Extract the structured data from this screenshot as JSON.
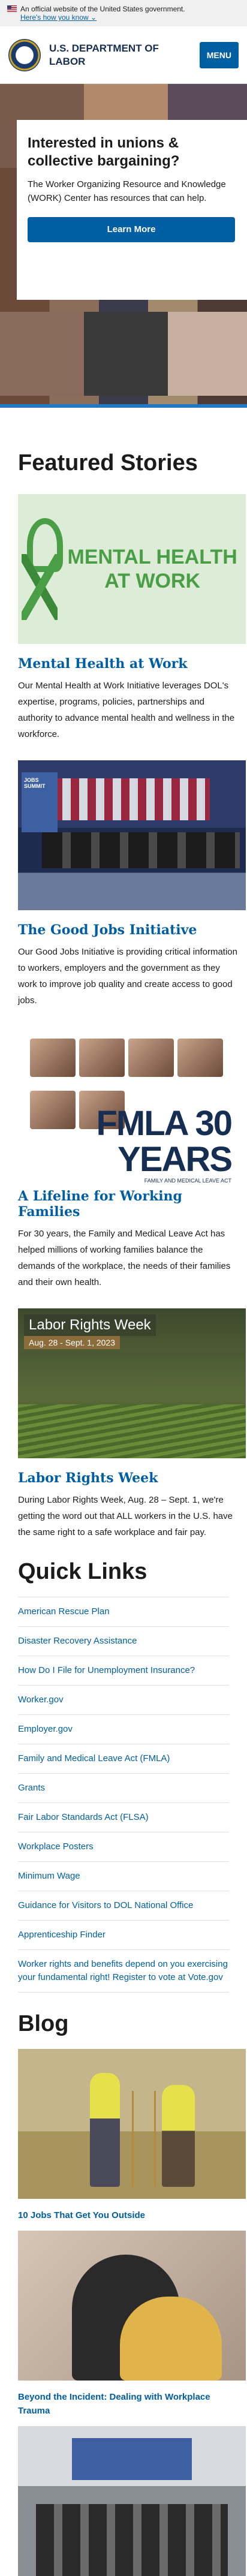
{
  "gov_banner": {
    "text": "An official website of the United States government.",
    "link": "Here's how you know"
  },
  "header": {
    "agency": "U.S. DEPARTMENT OF LABOR",
    "menu": "MENU"
  },
  "hero": {
    "title": "Interested in unions & collective bargaining?",
    "text": "The Worker Organizing Resource and Knowledge (WORK) Center has resources that can help.",
    "cta": "Learn More"
  },
  "featured": {
    "heading": "Featured Stories",
    "stories": [
      {
        "title": "Mental Health at Work",
        "image_text": "MENTAL HEALTH AT WORK",
        "text": "Our Mental Health at Work Initiative leverages DOL's expertise, programs, policies, partnerships and authority to advance mental health and wellness in the workforce."
      },
      {
        "title": "The Good Jobs Initiative",
        "image_text": "JOBS SUMMIT",
        "text": "Our Good Jobs Initiative is providing critical information to workers, employers and the government as they work to improve job quality and create access to good jobs."
      },
      {
        "title": "A Lifeline for Working Families",
        "image_text": "FMLA 30 YEARS",
        "image_subtext": "FAMILY AND MEDICAL LEAVE ACT",
        "text": "For 30 years, the Family and Medical Leave Act has helped millions of working families balance the demands of the workplace, the needs of their families and their own health."
      },
      {
        "title": "Labor Rights Week",
        "image_text": "Labor Rights Week",
        "image_date": "Aug. 28 - Sept. 1, 2023",
        "text": "During Labor Rights Week, Aug. 28 – Sept. 1, we're getting the word out that ALL workers in the U.S. have the same right to a safe workplace and fair pay."
      }
    ]
  },
  "quicklinks": {
    "heading": "Quick Links",
    "items": [
      "American Rescue Plan",
      "Disaster Recovery Assistance",
      "How Do I File for Unemployment Insurance?",
      "Worker.gov",
      "Employer.gov",
      "Family and Medical Leave Act (FMLA)",
      "Grants",
      "Fair Labor Standards Act (FLSA)",
      "Workplace Posters",
      "Minimum Wage",
      "Guidance for Visitors to DOL National Office",
      "Apprenticeship Finder",
      "Worker rights and benefits depend on you exercising your fundamental right! Register to vote at Vote.gov"
    ]
  },
  "blog": {
    "heading": "Blog",
    "posts": [
      "10 Jobs That Get You Outside",
      "Beyond the Incident: Dealing with Workplace Trauma"
    ]
  },
  "colors": {
    "primary": "#005ea2",
    "agency_navy": "#162e51",
    "mental_health_green": "#4a9e45"
  }
}
